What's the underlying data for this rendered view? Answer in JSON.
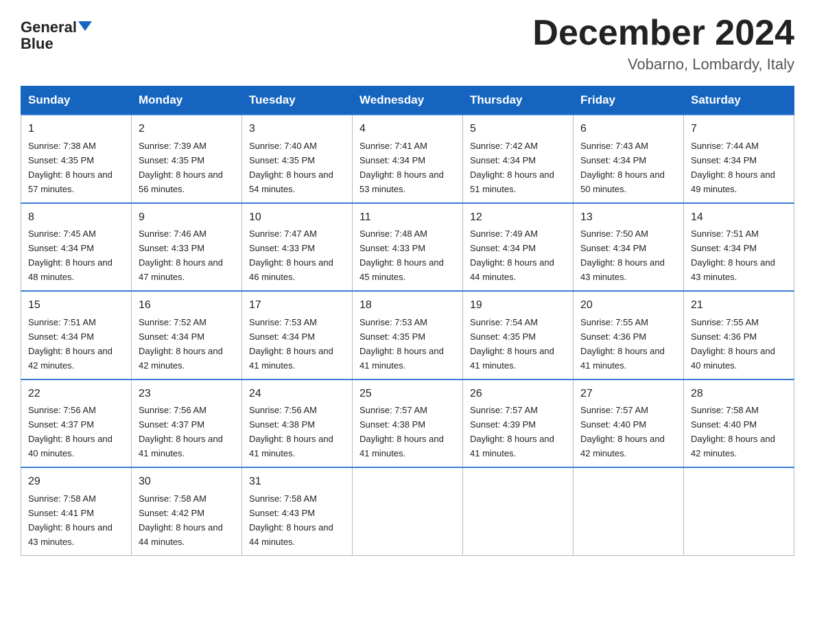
{
  "header": {
    "logo_general": "General",
    "logo_blue": "Blue",
    "month_title": "December 2024",
    "location": "Vobarno, Lombardy, Italy"
  },
  "weekdays": [
    "Sunday",
    "Monday",
    "Tuesday",
    "Wednesday",
    "Thursday",
    "Friday",
    "Saturday"
  ],
  "weeks": [
    [
      {
        "day": "1",
        "sunrise": "7:38 AM",
        "sunset": "4:35 PM",
        "daylight": "8 hours and 57 minutes."
      },
      {
        "day": "2",
        "sunrise": "7:39 AM",
        "sunset": "4:35 PM",
        "daylight": "8 hours and 56 minutes."
      },
      {
        "day": "3",
        "sunrise": "7:40 AM",
        "sunset": "4:35 PM",
        "daylight": "8 hours and 54 minutes."
      },
      {
        "day": "4",
        "sunrise": "7:41 AM",
        "sunset": "4:34 PM",
        "daylight": "8 hours and 53 minutes."
      },
      {
        "day": "5",
        "sunrise": "7:42 AM",
        "sunset": "4:34 PM",
        "daylight": "8 hours and 51 minutes."
      },
      {
        "day": "6",
        "sunrise": "7:43 AM",
        "sunset": "4:34 PM",
        "daylight": "8 hours and 50 minutes."
      },
      {
        "day": "7",
        "sunrise": "7:44 AM",
        "sunset": "4:34 PM",
        "daylight": "8 hours and 49 minutes."
      }
    ],
    [
      {
        "day": "8",
        "sunrise": "7:45 AM",
        "sunset": "4:34 PM",
        "daylight": "8 hours and 48 minutes."
      },
      {
        "day": "9",
        "sunrise": "7:46 AM",
        "sunset": "4:33 PM",
        "daylight": "8 hours and 47 minutes."
      },
      {
        "day": "10",
        "sunrise": "7:47 AM",
        "sunset": "4:33 PM",
        "daylight": "8 hours and 46 minutes."
      },
      {
        "day": "11",
        "sunrise": "7:48 AM",
        "sunset": "4:33 PM",
        "daylight": "8 hours and 45 minutes."
      },
      {
        "day": "12",
        "sunrise": "7:49 AM",
        "sunset": "4:34 PM",
        "daylight": "8 hours and 44 minutes."
      },
      {
        "day": "13",
        "sunrise": "7:50 AM",
        "sunset": "4:34 PM",
        "daylight": "8 hours and 43 minutes."
      },
      {
        "day": "14",
        "sunrise": "7:51 AM",
        "sunset": "4:34 PM",
        "daylight": "8 hours and 43 minutes."
      }
    ],
    [
      {
        "day": "15",
        "sunrise": "7:51 AM",
        "sunset": "4:34 PM",
        "daylight": "8 hours and 42 minutes."
      },
      {
        "day": "16",
        "sunrise": "7:52 AM",
        "sunset": "4:34 PM",
        "daylight": "8 hours and 42 minutes."
      },
      {
        "day": "17",
        "sunrise": "7:53 AM",
        "sunset": "4:34 PM",
        "daylight": "8 hours and 41 minutes."
      },
      {
        "day": "18",
        "sunrise": "7:53 AM",
        "sunset": "4:35 PM",
        "daylight": "8 hours and 41 minutes."
      },
      {
        "day": "19",
        "sunrise": "7:54 AM",
        "sunset": "4:35 PM",
        "daylight": "8 hours and 41 minutes."
      },
      {
        "day": "20",
        "sunrise": "7:55 AM",
        "sunset": "4:36 PM",
        "daylight": "8 hours and 41 minutes."
      },
      {
        "day": "21",
        "sunrise": "7:55 AM",
        "sunset": "4:36 PM",
        "daylight": "8 hours and 40 minutes."
      }
    ],
    [
      {
        "day": "22",
        "sunrise": "7:56 AM",
        "sunset": "4:37 PM",
        "daylight": "8 hours and 40 minutes."
      },
      {
        "day": "23",
        "sunrise": "7:56 AM",
        "sunset": "4:37 PM",
        "daylight": "8 hours and 41 minutes."
      },
      {
        "day": "24",
        "sunrise": "7:56 AM",
        "sunset": "4:38 PM",
        "daylight": "8 hours and 41 minutes."
      },
      {
        "day": "25",
        "sunrise": "7:57 AM",
        "sunset": "4:38 PM",
        "daylight": "8 hours and 41 minutes."
      },
      {
        "day": "26",
        "sunrise": "7:57 AM",
        "sunset": "4:39 PM",
        "daylight": "8 hours and 41 minutes."
      },
      {
        "day": "27",
        "sunrise": "7:57 AM",
        "sunset": "4:40 PM",
        "daylight": "8 hours and 42 minutes."
      },
      {
        "day": "28",
        "sunrise": "7:58 AM",
        "sunset": "4:40 PM",
        "daylight": "8 hours and 42 minutes."
      }
    ],
    [
      {
        "day": "29",
        "sunrise": "7:58 AM",
        "sunset": "4:41 PM",
        "daylight": "8 hours and 43 minutes."
      },
      {
        "day": "30",
        "sunrise": "7:58 AM",
        "sunset": "4:42 PM",
        "daylight": "8 hours and 44 minutes."
      },
      {
        "day": "31",
        "sunrise": "7:58 AM",
        "sunset": "4:43 PM",
        "daylight": "8 hours and 44 minutes."
      },
      null,
      null,
      null,
      null
    ]
  ]
}
